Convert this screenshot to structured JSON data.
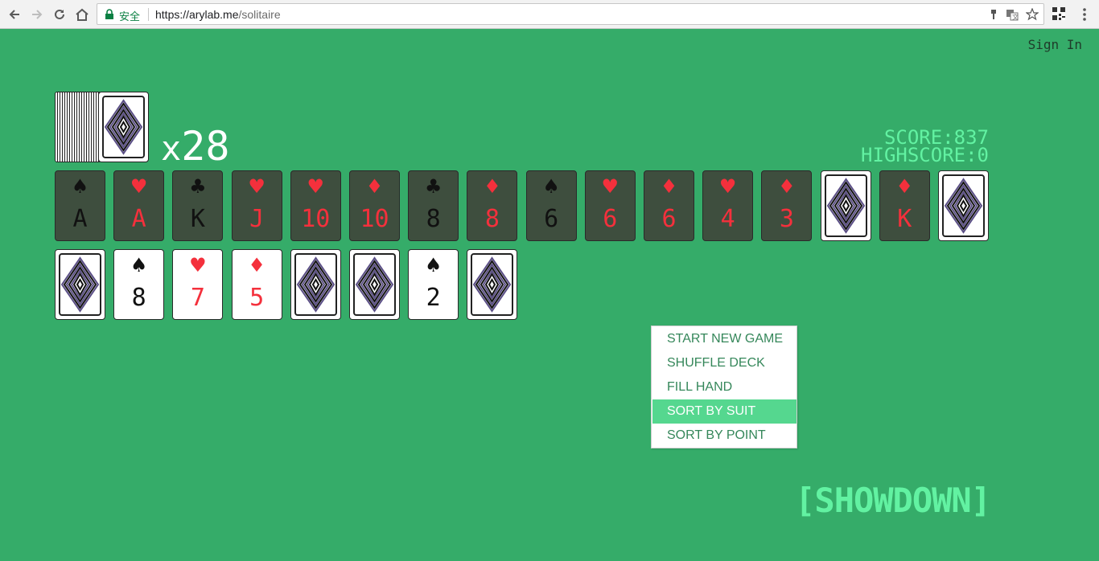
{
  "browser": {
    "secure_label": "安全",
    "url_host": "https://arylab.me",
    "url_path": "/solitaire"
  },
  "header": {
    "sign_in": "Sign In"
  },
  "deck": {
    "count_prefix": "x",
    "count": "28"
  },
  "score": {
    "score_label": "SCORE:",
    "score_value": "837",
    "highscore_label": "HIGHSCORE:",
    "highscore_value": "0"
  },
  "played_cards": [
    {
      "suit": "♠",
      "rank": "A",
      "color": "black"
    },
    {
      "suit": "♥",
      "rank": "A",
      "color": "red"
    },
    {
      "suit": "♣",
      "rank": "K",
      "color": "black"
    },
    {
      "suit": "♥",
      "rank": "J",
      "color": "red"
    },
    {
      "suit": "♥",
      "rank": "10",
      "color": "red"
    },
    {
      "suit": "♦",
      "rank": "10",
      "color": "red"
    },
    {
      "suit": "♣",
      "rank": "8",
      "color": "black"
    },
    {
      "suit": "♦",
      "rank": "8",
      "color": "red"
    },
    {
      "suit": "♠",
      "rank": "6",
      "color": "black"
    },
    {
      "suit": "♥",
      "rank": "6",
      "color": "red"
    },
    {
      "suit": "♦",
      "rank": "6",
      "color": "red"
    },
    {
      "suit": "♥",
      "rank": "4",
      "color": "red"
    },
    {
      "suit": "♦",
      "rank": "3",
      "color": "red"
    },
    {
      "face_down": true
    },
    {
      "suit": "♦",
      "rank": "K",
      "color": "red"
    },
    {
      "face_down": true
    }
  ],
  "hand_cards": [
    {
      "face_down": true
    },
    {
      "suit": "♠",
      "rank": "8",
      "color": "black"
    },
    {
      "suit": "♥",
      "rank": "7",
      "color": "red"
    },
    {
      "suit": "♦",
      "rank": "5",
      "color": "red"
    },
    {
      "face_down": true
    },
    {
      "face_down": true
    },
    {
      "suit": "♠",
      "rank": "2",
      "color": "black"
    },
    {
      "face_down": true
    }
  ],
  "context_menu": {
    "items": [
      {
        "label": "START NEW GAME",
        "active": false
      },
      {
        "label": "SHUFFLE DECK",
        "active": false
      },
      {
        "label": "FILL HAND",
        "active": false
      },
      {
        "label": "SORT BY SUIT",
        "active": true
      },
      {
        "label": "SORT BY POINT",
        "active": false
      }
    ]
  },
  "showdown_label": "[SHOWDOWN]",
  "colors": {
    "background": "#35ac69",
    "accent": "#62f2a2",
    "card_played": "#3e4e3e",
    "red_suit": "#f4303c",
    "menu_active": "#55d78f"
  }
}
